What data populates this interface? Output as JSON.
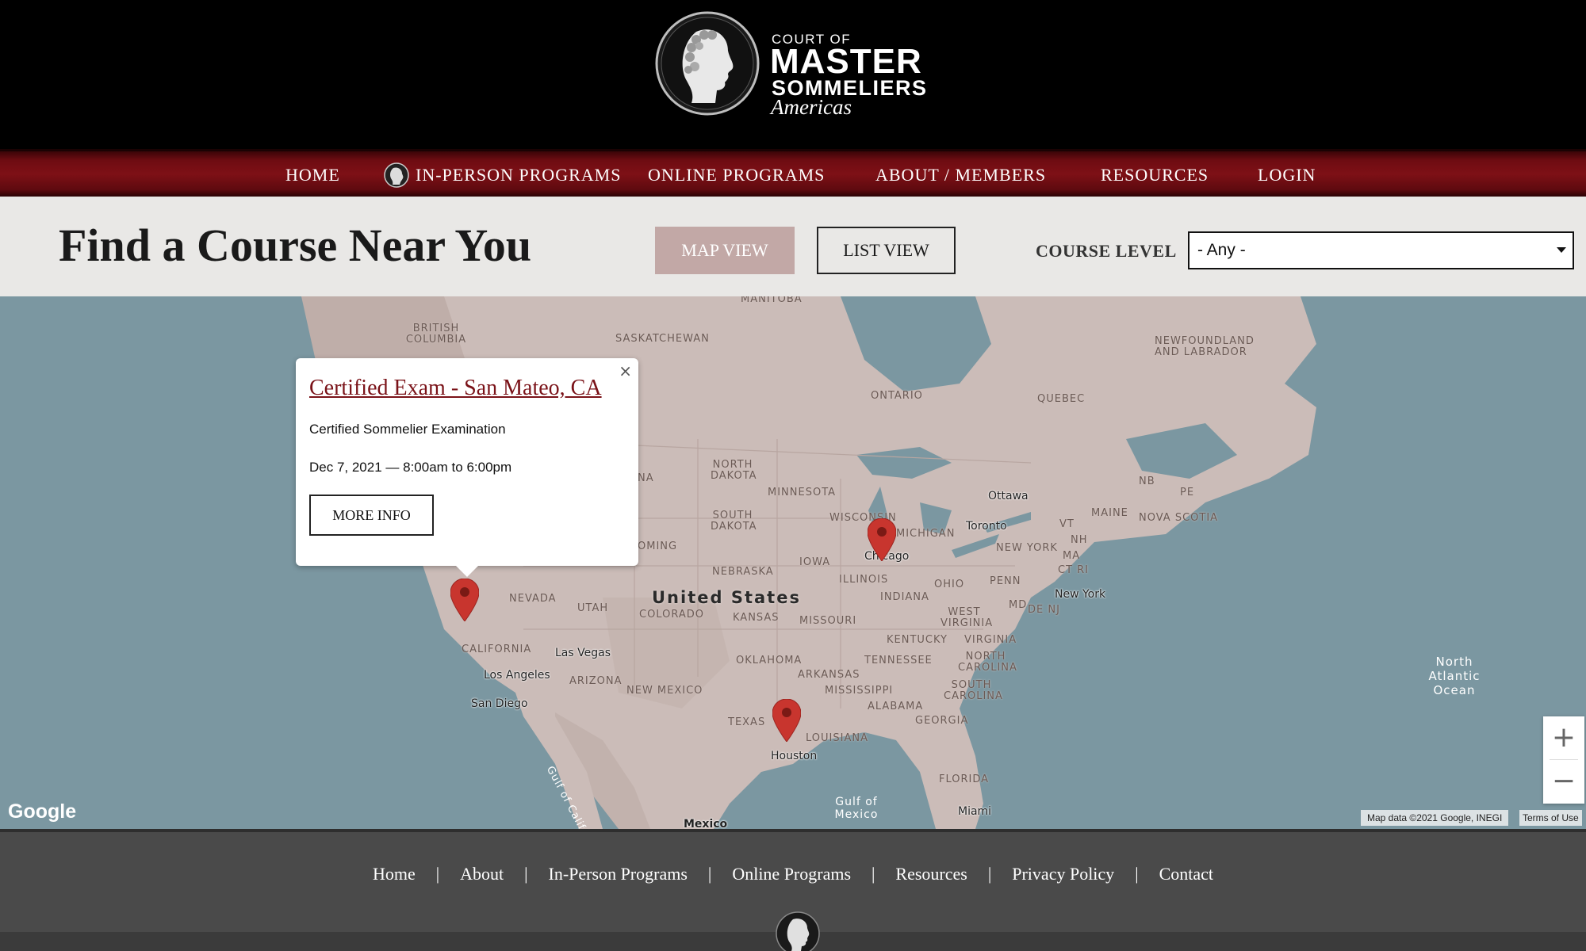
{
  "brand": {
    "line1": "COURT OF",
    "line2": "MASTER",
    "line3": "SOMMELIERS",
    "line4": "Americas"
  },
  "nav": {
    "items": [
      {
        "label": "HOME"
      },
      {
        "label": "IN-PERSON PROGRAMS"
      },
      {
        "label": "ONLINE PROGRAMS"
      },
      {
        "label": "ABOUT / MEMBERS"
      },
      {
        "label": "RESOURCES"
      },
      {
        "label": "LOGIN"
      }
    ]
  },
  "filter": {
    "title": "Find a Course Near You",
    "map_view_label": "MAP VIEW",
    "list_view_label": "LIST VIEW",
    "course_level_label": "COURSE LEVEL",
    "course_level_value": "- Any -"
  },
  "map": {
    "country_label": "United States",
    "region_labels": {
      "manitoba": "MANITOBA",
      "british_columbia": "BRITISH COLUMBIA",
      "saskatchewan": "SASKATCHEWAN",
      "newfoundland": "NEWFOUNDLAND AND LABRADOR",
      "ontario": "ONTARIO",
      "quebec": "QUEBEC",
      "north_dakota": "NORTH DAKOTA",
      "south_dakota": "SOUTH DAKOTA",
      "minnesota": "MINNESOTA",
      "wisconsin": "WISCONSIN",
      "michigan": "MICHIGAN",
      "nebraska": "NEBRASKA",
      "iowa": "IOWA",
      "illinois": "ILLINOIS",
      "indiana": "INDIANA",
      "ohio": "OHIO",
      "penn": "PENN",
      "new_york_state": "NEW YORK",
      "maine": "MAINE",
      "nova_scotia": "NOVA SCOTIA",
      "nb": "NB",
      "pe": "PE",
      "vt": "VT",
      "nh": "NH",
      "ma": "MA",
      "ct_ri": "CT RI",
      "md": "MD",
      "de_nj": "DE NJ",
      "nevada": "NEVADA",
      "utah": "UTAH",
      "colorado": "COLORADO",
      "kansas": "KANSAS",
      "missouri": "MISSOURI",
      "kentucky": "KENTUCKY",
      "west_virginia": "WEST VIRGINIA",
      "virginia": "VIRGINIA",
      "california": "CALIFORNIA",
      "arizona": "ARIZONA",
      "new_mexico": "NEW MEXICO",
      "oklahoma": "OKLAHOMA",
      "arkansas": "ARKANSAS",
      "tennessee": "TENNESSEE",
      "north_carolina": "NORTH CAROLINA",
      "south_carolina": "SOUTH CAROLINA",
      "mississippi": "MISSISSIPPI",
      "alabama": "ALABAMA",
      "georgia": "GEORGIA",
      "texas": "TEXAS",
      "louisiana": "LOUISIANA",
      "florida": "FLORIDA",
      "wyoming": "OMING",
      "idaho_frag": "NA"
    },
    "cities": {
      "ottawa": "Ottawa",
      "toronto": "Toronto",
      "chicago": "Chicago",
      "new_york": "New York",
      "las_vegas": "Las Vegas",
      "los_angeles": "Los Angeles",
      "san_diego": "San Diego",
      "houston": "Houston",
      "miami": "Miami",
      "mexico": "Mexico"
    },
    "water": {
      "atlantic_1": "North",
      "atlantic_2": "Atlantic",
      "atlantic_3": "Ocean",
      "gulf_mexico_1": "Gulf of",
      "gulf_mexico_2": "Mexico",
      "gulf_california": "Gulf of California"
    },
    "info_window": {
      "title": "Certified Exam - San Mateo, CA",
      "description": "Certified Sommelier Examination",
      "date": "Dec 7, 2021 — 8:00am to 6:00pm",
      "more_label": "MORE INFO",
      "close_glyph": "×"
    },
    "google_label": "Google",
    "zoom_in": "+",
    "zoom_out": "−",
    "attribution": "Map data ©2021 Google, INEGI",
    "terms": "Terms of Use",
    "colors": {
      "water": "#7b97a1",
      "land": "#cbbcb8",
      "marker": "#c8352e"
    }
  },
  "footer": {
    "links": [
      "Home",
      "About",
      "In-Person Programs",
      "Online Programs",
      "Resources",
      "Privacy Policy",
      "Contact"
    ],
    "separator": "|"
  }
}
